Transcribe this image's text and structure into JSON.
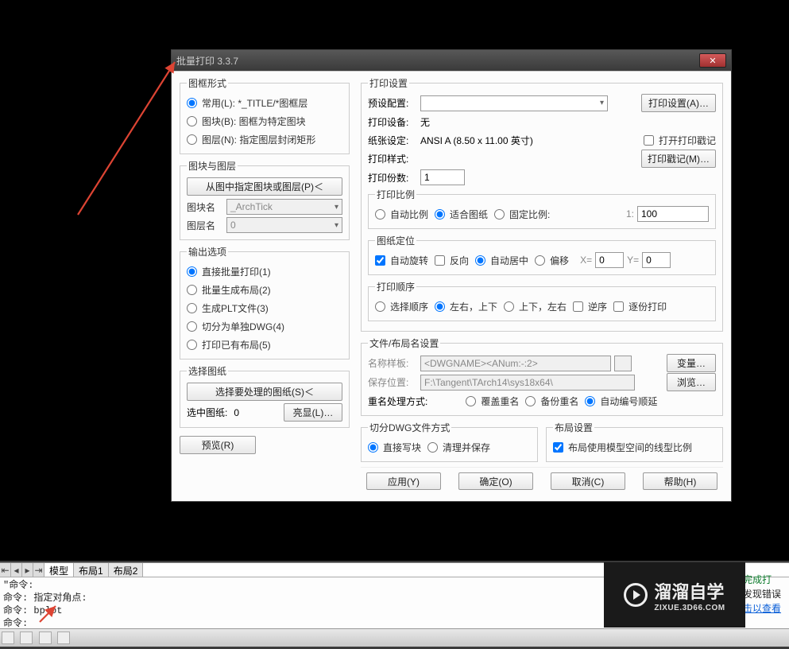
{
  "dialog": {
    "title": "批量打印 3.3.7",
    "frame_style": {
      "legend": "图框形式",
      "opt_common": "常用(L): *_TITLE/*图框层",
      "opt_block": "图块(B): 图框为特定图块",
      "opt_layer": "图层(N): 指定图层封闭矩形"
    },
    "block_layer": {
      "legend": "图块与图层",
      "pick_btn": "从图中指定图块或图层(P)＜",
      "block_label": "图块名",
      "block_val": "_ArchTick",
      "layer_label": "图层名",
      "layer_val": "0"
    },
    "output": {
      "legend": "输出选项",
      "opt1": "直接批量打印(1)",
      "opt2": "批量生成布局(2)",
      "opt3": "生成PLT文件(3)",
      "opt4": "切分为单独DWG(4)",
      "opt5": "打印已有布局(5)"
    },
    "select": {
      "legend": "选择图纸",
      "select_btn": "选择要处理的图纸(S)＜",
      "count_label": "选中图纸:",
      "count_val": "0",
      "highlight_btn": "亮显(L)…"
    },
    "preview_btn": "预览(R)",
    "print_settings": {
      "legend": "打印设置",
      "preset_label": "预设配置:",
      "preset_val": "",
      "settings_btn": "打印设置(A)…",
      "device_label": "打印设备:",
      "device_val": "无",
      "paper_label": "纸张设定:",
      "paper_val": "ANSI A (8.50 x 11.00 英寸)",
      "style_label": "打印样式:",
      "style_val": "",
      "stamp_chk": "打开打印戳记",
      "stamp_btn": "打印戳记(M)…",
      "copies_label": "打印份数:",
      "copies_val": "1"
    },
    "scale": {
      "legend": "打印比例",
      "auto": "自动比例",
      "fit": "适合图纸",
      "fixed": "固定比例:",
      "ratio_label": "1:",
      "ratio_val": "100"
    },
    "orient": {
      "legend": "图纸定位",
      "autorot": "自动旋转",
      "reverse": "反向",
      "center": "自动居中",
      "offset": "偏移",
      "xlabel": "X=",
      "xval": "0",
      "ylabel": "Y=",
      "yval": "0"
    },
    "order": {
      "legend": "打印顺序",
      "sel": "选择顺序",
      "lr": "左右，上下",
      "ud": "上下，左右",
      "rev": "逆序",
      "each": "逐份打印"
    },
    "filenames": {
      "legend": "文件/布局名设置",
      "tmpl_label": "名称样板:",
      "tmpl_val": "<DWGNAME><ANum:-:2>",
      "var_btn": "变量…",
      "path_label": "保存位置:",
      "path_val": "F:\\Tangent\\TArch14\\sys18x64\\",
      "browse_btn": "浏览…",
      "dup_label": "重名处理方式:",
      "dup_over": "覆盖重名",
      "dup_bak": "备份重名",
      "dup_auto": "自动编号顺延"
    },
    "split": {
      "legend": "切分DWG文件方式",
      "direct": "直接写块",
      "clean": "清理并保存"
    },
    "layout": {
      "legend": "布局设置",
      "model_line": "布局使用模型空间的线型比例"
    },
    "footer": {
      "apply": "应用(Y)",
      "ok": "确定(O)",
      "cancel": "取消(C)",
      "help": "帮助(H)"
    }
  },
  "tabs": {
    "model": "模型",
    "t1": "布局1",
    "t2": "布局2"
  },
  "cmd": {
    "l1": "\"命令:",
    "l2": "命令: 指定对角点:",
    "l3": "命令: bplot",
    "l4": "命令:"
  },
  "status": {
    "done": "完成打",
    "noerr": "未发现错误",
    "click": "单击以查看"
  },
  "watermark": {
    "brand": "溜溜自学",
    "url": "ZIXUE.3D66.COM"
  }
}
